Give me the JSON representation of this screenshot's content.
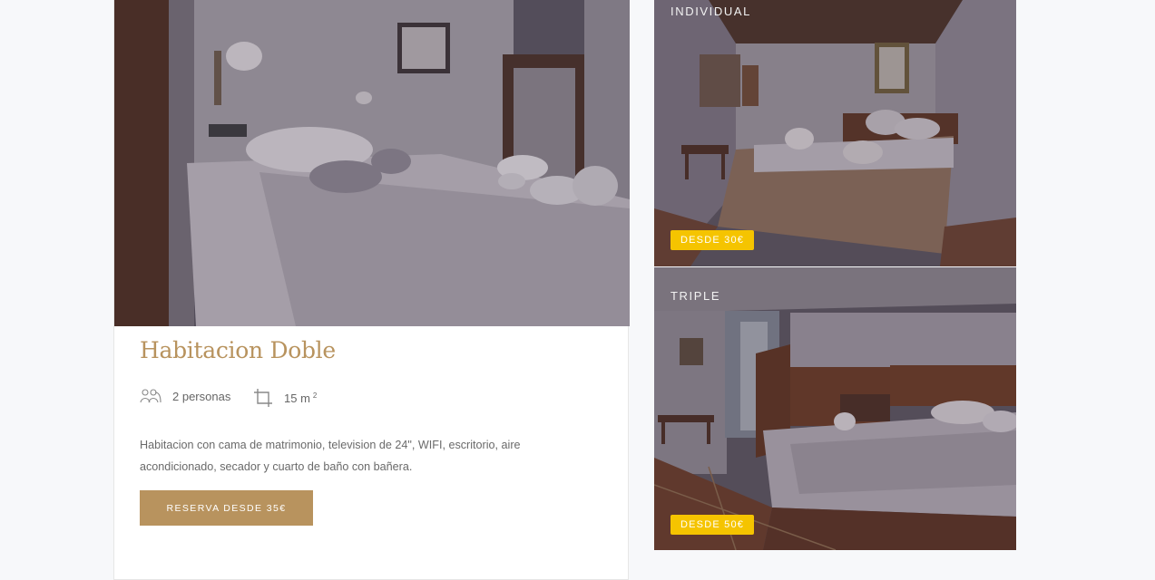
{
  "main_room": {
    "title": "Habitacion Doble",
    "capacity": "2 personas",
    "size": "15 m",
    "size_unit_exp": "2",
    "description": "Habitacion con cama de matrimonio, television de 24\", WIFI, escritorio, aire acondicionado, secador y cuarto de baño con bañera.",
    "button_label": "RESERVA DESDE 35€",
    "icons": [
      "people-icon",
      "crop-area-icon"
    ]
  },
  "side_rooms": [
    {
      "label": "INDIVIDUAL",
      "price_badge": "DESDE 30€"
    },
    {
      "label": "TRIPLE",
      "price_badge": "DESDE 50€"
    }
  ],
  "colors": {
    "accent": "#b8935e",
    "badge": "#f5c400",
    "page_bg": "#f7f8fa",
    "text_muted": "#6a6a6a"
  }
}
